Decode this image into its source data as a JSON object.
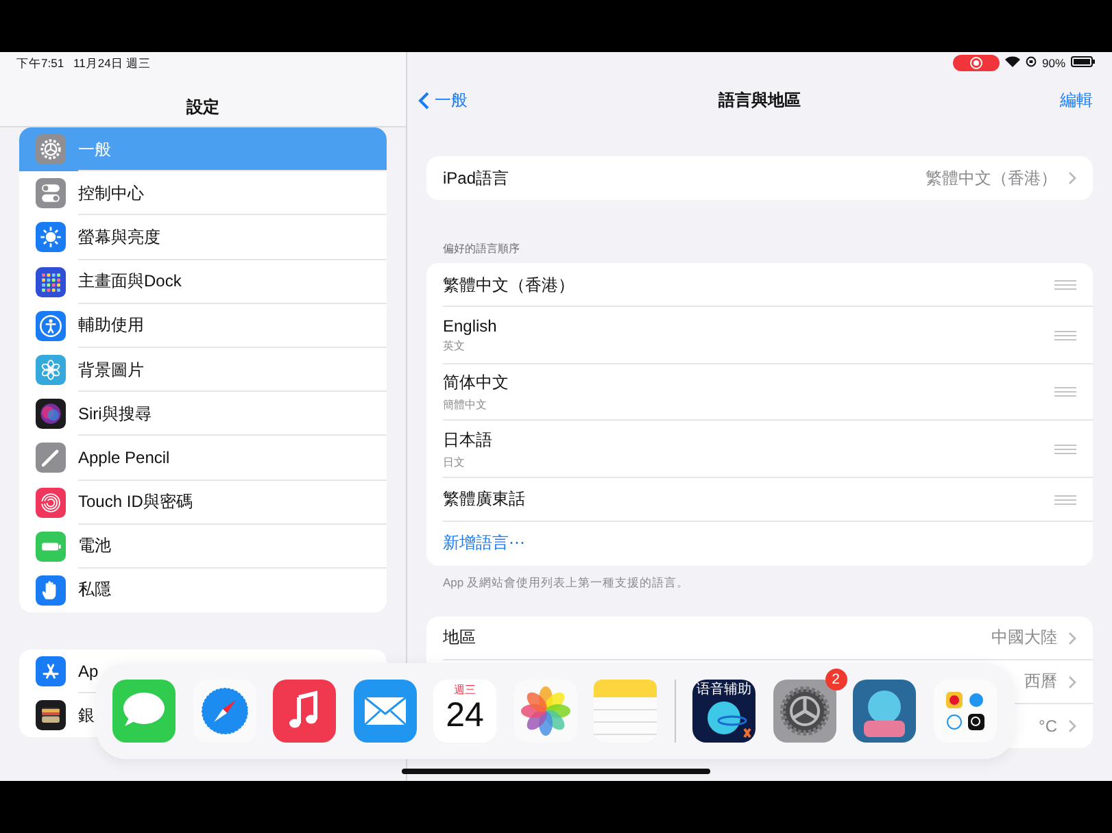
{
  "status_bar": {
    "time": "下午7:51",
    "date": "11月24日 週三",
    "battery": "90%",
    "recording": true
  },
  "sidebar": {
    "title": "設定",
    "groups": [
      [
        {
          "kind": "gear",
          "label": "一般",
          "selected": true
        },
        {
          "kind": "toggles",
          "label": "控制中心",
          "selected": false
        },
        {
          "kind": "sun",
          "label": "螢幕與亮度",
          "selected": false
        },
        {
          "kind": "grid",
          "label": "主畫面與Dock",
          "selected": false
        },
        {
          "kind": "accessibility",
          "label": "輔助使用",
          "selected": false
        },
        {
          "kind": "flower",
          "label": "背景圖片",
          "selected": false
        },
        {
          "kind": "siri",
          "label": "Siri與搜尋",
          "selected": false
        },
        {
          "kind": "pencil",
          "label": "Apple Pencil",
          "selected": false
        },
        {
          "kind": "fingerprint",
          "label": "Touch ID與密碼",
          "selected": false
        },
        {
          "kind": "battery",
          "label": "電池",
          "selected": false
        },
        {
          "kind": "hand",
          "label": "私隱",
          "selected": false
        }
      ],
      [
        {
          "kind": "appstore",
          "label": "Ap",
          "selected": false
        },
        {
          "kind": "wallet",
          "label": "銀",
          "selected": false
        }
      ]
    ]
  },
  "detail": {
    "back": "一般",
    "title": "語言與地區",
    "edit": "編輯",
    "ipad_language": {
      "label": "iPad語言",
      "value": "繁體中文（香港）"
    },
    "preferred_header": "偏好的語言順序",
    "languages": [
      {
        "name": "繁體中文（香港）"
      },
      {
        "name": "English",
        "subtitle": "英文"
      },
      {
        "name": "简体中文",
        "subtitle": "簡體中文"
      },
      {
        "name": "日本語",
        "subtitle": "日文"
      },
      {
        "name": "繁體廣東話"
      }
    ],
    "add_language": "新增語言⋯",
    "footer": "App 及網站會使用列表上第一種支援的語言。",
    "region_rows": [
      {
        "label": "地區",
        "value": "中國大陸"
      },
      {
        "value": "西曆"
      },
      {
        "value": "°C"
      }
    ]
  },
  "dock": {
    "apps": [
      {
        "kind": "messages"
      },
      {
        "kind": "safari"
      },
      {
        "kind": "music"
      },
      {
        "kind": "mail"
      },
      {
        "kind": "calendar",
        "weekday": "週三",
        "day": "24"
      },
      {
        "kind": "photos"
      },
      {
        "kind": "notes"
      },
      {
        "kind": "divider"
      },
      {
        "kind": "voice",
        "label": "语音辅助"
      },
      {
        "kind": "settings",
        "badge": "2"
      },
      {
        "kind": "game"
      },
      {
        "kind": "folder"
      }
    ]
  }
}
